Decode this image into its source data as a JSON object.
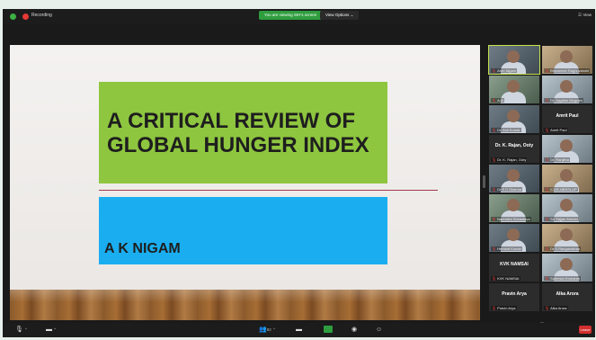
{
  "topbar": {
    "recording_label": "Recording",
    "share_notice": "You are viewing SIH's screen",
    "view_options": "View Options ⌄",
    "view_label": "View"
  },
  "slide": {
    "title": "A CRITICAL REVIEW OF GLOBAL HUNGER INDEX",
    "author": "A K NIGAM",
    "colors": {
      "title_box": "#8ec63f",
      "author_box": "#1aaef0",
      "rule": "#a33a4b"
    }
  },
  "participants": [
    {
      "label": "Arun Nigam",
      "photo": true
    },
    {
      "label": "Bhuwnesh Raghuvanshi",
      "photo": true
    },
    {
      "label": "AJA",
      "photo": true
    },
    {
      "label": "Dr. Jagdish Mogram",
      "photo": true
    },
    {
      "label": "Dr. Anil Kumar",
      "photo": true
    },
    {
      "label": "Amrit Paul",
      "name_only": "Amrit Paul"
    },
    {
      "label": "Dr. K. Rajan, Ooty",
      "name_only": "Dr. K. Rajan, Ooty"
    },
    {
      "label": "Dr. Ranjitha",
      "photo": true
    },
    {
      "label": "Dr S D Sharma",
      "photo": true
    },
    {
      "label": "ICAR-NBSSLUP",
      "photo": true
    },
    {
      "label": "Narendra Srivastava",
      "photo": true
    },
    {
      "label": "Sri Sajjan Ahmed",
      "photo": true
    },
    {
      "label": "Hemant Kumar",
      "photo": true
    },
    {
      "label": "Dr S.Ranganathan",
      "photo": true
    },
    {
      "label": "KVK NAMSAI",
      "name_only": "KVK NAMSAI"
    },
    {
      "label": "Suleman Kumaran",
      "photo": true
    },
    {
      "label": "Pravin Arya",
      "name_only": "Pravin Arya"
    },
    {
      "label": "Alka Arora",
      "name_only": "Alka Arora"
    }
  ],
  "toolbar": {
    "participants_count": "82",
    "end_label": "Leave"
  }
}
